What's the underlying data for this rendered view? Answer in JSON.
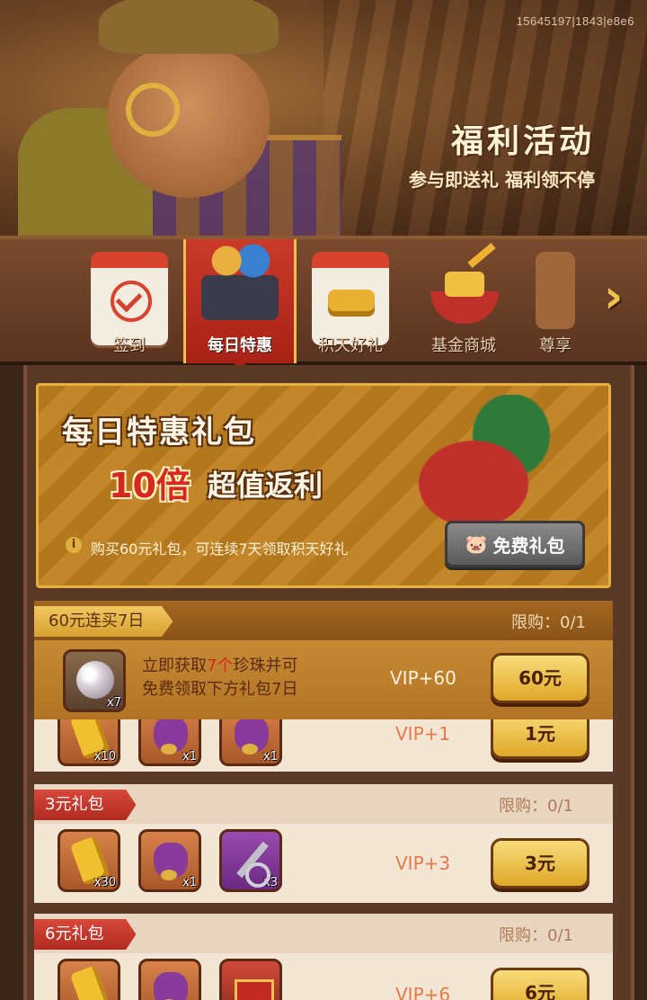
{
  "header": {
    "uid": "15645197|1843|e8e6",
    "title": "福利活动",
    "subtitle": "参与即送礼 福利领不停"
  },
  "tabs": [
    {
      "label": "签到",
      "icon": "calendar-check-icon",
      "active": false
    },
    {
      "label": "每日特惠",
      "icon": "shopping-cart-icon",
      "active": true
    },
    {
      "label": "积天好礼",
      "icon": "calendar-gold-icon",
      "active": false
    },
    {
      "label": "基金商城",
      "icon": "fund-bowl-icon",
      "active": false
    },
    {
      "label": "尊享",
      "icon": "vip-icon",
      "active": false
    }
  ],
  "promo": {
    "title": "每日特惠礼包",
    "highlight": "10倍",
    "highlight_rest": "超值返利",
    "note": "购买60元礼包，可连续7天领取积天好礼",
    "free_button": "免费礼包"
  },
  "packs": {
    "p60": {
      "tag": "60元连买7日",
      "limit": "限购：0/1",
      "item_count": "x7",
      "desc_line1_a": "立即获取",
      "desc_line1_b": "7个",
      "desc_line1_c": "珍珠并可",
      "desc_line2": "免费领取下方礼包7日",
      "vip": "VIP+60",
      "price": "60元"
    },
    "p1": {
      "counts": [
        "x10",
        "x1",
        "x1"
      ],
      "vip": "VIP+1",
      "price": "1元"
    },
    "p3": {
      "tag": "3元礼包",
      "limit": "限购：0/1",
      "counts": [
        "x30",
        "x1",
        "x3"
      ],
      "vip": "VIP+3",
      "price": "3元"
    },
    "p6": {
      "tag": "6元礼包",
      "limit": "限购：0/1",
      "vip": "VIP+6",
      "price": "6元"
    }
  }
}
